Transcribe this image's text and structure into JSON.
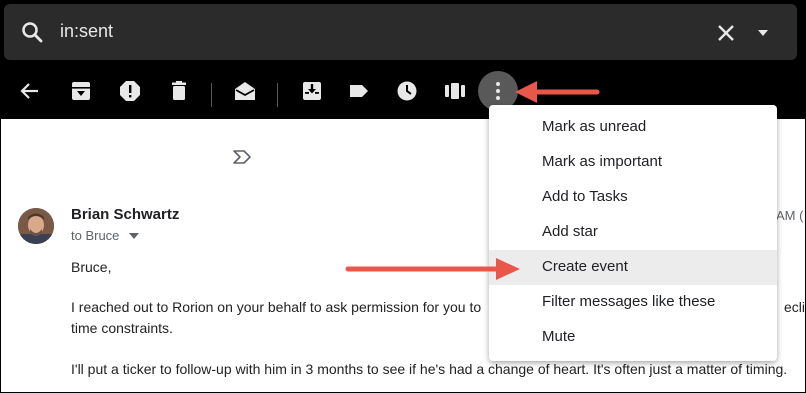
{
  "search": {
    "query": "in:sent"
  },
  "toolbar": {
    "icons": [
      "back-icon",
      "archive-icon",
      "report-spam-icon",
      "delete-icon",
      "mark-unread-icon",
      "move-to-inbox-icon",
      "label-icon",
      "snooze-icon",
      "move-icon",
      "more-vert-icon"
    ]
  },
  "message": {
    "sender": "Brian Schwartz",
    "to": "to Bruce",
    "time_fragment": "AM (",
    "greeting": "Bruce,",
    "line1": "I reached out to Rorion on your behalf to ask permission for you to",
    "line1_tail": "eclin",
    "line2": "time constraints.",
    "line3": "I'll put a ticker to follow-up with him in 3 months to see if he's had a change of heart. It's often just a matter of timing."
  },
  "menu": {
    "items": [
      {
        "label": "Mark as unread"
      },
      {
        "label": "Mark as important"
      },
      {
        "label": "Add to Tasks"
      },
      {
        "label": "Add star"
      },
      {
        "label": "Create event",
        "highlighted": true
      },
      {
        "label": "Filter messages like these"
      },
      {
        "label": "Mute"
      }
    ]
  },
  "colors": {
    "arrow": "#e8574a",
    "toolbar_bg": "#000000",
    "search_bg": "#2b2b2b",
    "highlight": "#ececec"
  }
}
